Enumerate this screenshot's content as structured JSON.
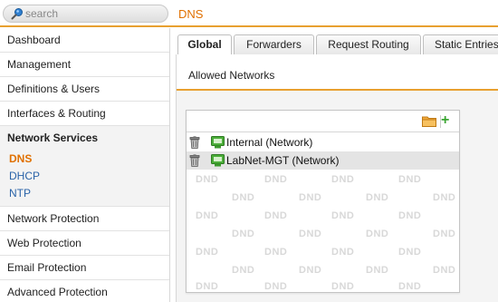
{
  "search": {
    "placeholder": "search"
  },
  "page_title": "DNS",
  "sidebar": {
    "items_top": [
      {
        "label": "Dashboard"
      },
      {
        "label": "Management"
      },
      {
        "label": "Definitions & Users"
      },
      {
        "label": "Interfaces & Routing"
      }
    ],
    "section": {
      "label": "Network Services",
      "subitems": [
        {
          "label": "DNS",
          "active": true
        },
        {
          "label": "DHCP",
          "active": false
        },
        {
          "label": "NTP",
          "active": false
        }
      ]
    },
    "items_bottom": [
      {
        "label": "Network Protection"
      },
      {
        "label": "Web Protection"
      },
      {
        "label": "Email Protection"
      },
      {
        "label": "Advanced Protection"
      }
    ]
  },
  "tabs": [
    {
      "label": "Global",
      "active": true
    },
    {
      "label": "Forwarders",
      "active": false
    },
    {
      "label": "Request Routing",
      "active": false
    },
    {
      "label": "Static Entries",
      "active": false
    }
  ],
  "panel": {
    "title": "Allowed Networks",
    "rows": [
      {
        "label": "Internal (Network)"
      },
      {
        "label": "LabNet-MGT (Network)"
      }
    ],
    "dnd_text": "DND"
  },
  "colors": {
    "accent_orange": "#e07000",
    "rule_orange": "#e8a030",
    "link_blue": "#2a63a8",
    "add_green": "#3aa531"
  },
  "icons": {
    "search": "search-icon",
    "folder": "folder-icon",
    "add": "add-icon",
    "trash": "trash-icon",
    "network": "network-icon"
  }
}
